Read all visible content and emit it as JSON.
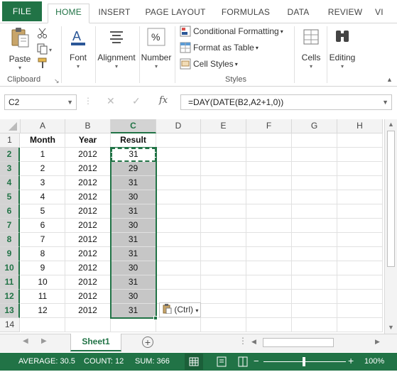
{
  "ribbon_tabs": {
    "file": "FILE",
    "home": "HOME",
    "insert": "INSERT",
    "page_layout": "PAGE LAYOUT",
    "formulas": "FORMULAS",
    "data": "DATA",
    "review": "REVIEW",
    "view": "VI"
  },
  "ribbon": {
    "paste": "Paste",
    "clipboard": "Clipboard",
    "font": "Font",
    "alignment": "Alignment",
    "number": "Number",
    "conditional_formatting": "Conditional Formatting",
    "format_as_table": "Format as Table",
    "cell_styles": "Cell Styles",
    "styles": "Styles",
    "cells": "Cells",
    "editing": "Editing"
  },
  "formula_bar": {
    "name_box": "C2",
    "formula": "=DAY(DATE(B2,A2+1,0))",
    "fx": "fx"
  },
  "columns": [
    "A",
    "B",
    "C",
    "D",
    "E",
    "F",
    "G",
    "H"
  ],
  "headers": {
    "month": "Month",
    "year": "Year",
    "result": "Result"
  },
  "rows": [
    {
      "row": "2",
      "month": "1",
      "year": "2012",
      "result": "31"
    },
    {
      "row": "3",
      "month": "2",
      "year": "2012",
      "result": "29"
    },
    {
      "row": "4",
      "month": "3",
      "year": "2012",
      "result": "31"
    },
    {
      "row": "5",
      "month": "4",
      "year": "2012",
      "result": "30"
    },
    {
      "row": "6",
      "month": "5",
      "year": "2012",
      "result": "31"
    },
    {
      "row": "7",
      "month": "6",
      "year": "2012",
      "result": "30"
    },
    {
      "row": "8",
      "month": "7",
      "year": "2012",
      "result": "31"
    },
    {
      "row": "9",
      "month": "8",
      "year": "2012",
      "result": "31"
    },
    {
      "row": "10",
      "month": "9",
      "year": "2012",
      "result": "30"
    },
    {
      "row": "11",
      "month": "10",
      "year": "2012",
      "result": "31"
    },
    {
      "row": "12",
      "month": "11",
      "year": "2012",
      "result": "30"
    },
    {
      "row": "13",
      "month": "12",
      "year": "2012",
      "result": "31"
    }
  ],
  "row1_label": "1",
  "row14_label": "14",
  "paste_options": "(Ctrl)",
  "sheet_tab": "Sheet1",
  "status": {
    "average": "AVERAGE: 30.5",
    "count": "COUNT: 12",
    "sum": "SUM: 366",
    "zoom": "100%"
  },
  "colors": {
    "accent": "#217346"
  }
}
